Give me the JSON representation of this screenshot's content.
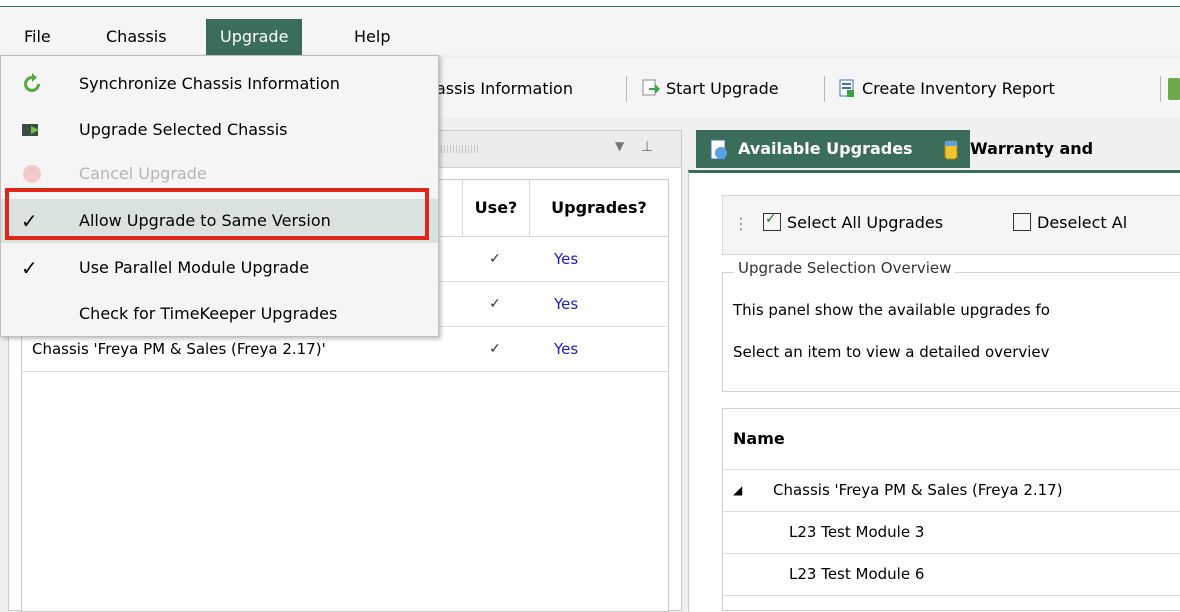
{
  "menubar": {
    "items": [
      {
        "label": "File"
      },
      {
        "label": "Chassis"
      },
      {
        "label": "Upgrade"
      },
      {
        "label": "Help"
      }
    ]
  },
  "toolbar": {
    "sync_label": "assis Information",
    "start_upgrade": "Start Upgrade",
    "inventory_report": "Create Inventory Report"
  },
  "upgrade_menu": {
    "items": [
      {
        "label": "Synchronize Chassis Information",
        "icon": "sync-icon",
        "enabled": true
      },
      {
        "label": "Upgrade Selected Chassis",
        "icon": "upgrade-chassis-icon",
        "enabled": true
      },
      {
        "label": "Cancel Upgrade",
        "icon": "cancel-icon",
        "enabled": false
      },
      {
        "label": "Allow Upgrade to Same Version",
        "checked": true,
        "highlighted": true
      },
      {
        "label": "Use Parallel Module Upgrade",
        "checked": true
      },
      {
        "label": "Check for TimeKeeper Upgrades",
        "checked": false
      }
    ],
    "check_glyph": "✓"
  },
  "chassis_grid": {
    "headers": [
      "Use?",
      "Upgrades?"
    ],
    "rows": [
      {
        "name": "",
        "use": true,
        "upgrades": "Yes"
      },
      {
        "name": "",
        "use": true,
        "upgrades": "Yes"
      },
      {
        "name": "Chassis 'Freya PM & Sales (Freya 2.17)'",
        "use": true,
        "upgrades": "Yes"
      }
    ]
  },
  "right_panel": {
    "tabs": [
      {
        "label": "Available Upgrades",
        "active": true
      },
      {
        "label": "Warranty and",
        "active": false
      }
    ],
    "select_all": "Select All Upgrades",
    "deselect_all": "Deselect Al",
    "group_title": "Upgrade Selection Overview",
    "overview_line1": "This panel show the available upgrades fo",
    "overview_line2": "Select an item to view a detailed overviev",
    "tree_header": "Name",
    "tree_rows": [
      {
        "label": "Chassis 'Freya PM & Sales (Freya 2.17)",
        "expander": "◢"
      },
      {
        "label": "L23 Test Module 3"
      },
      {
        "label": "L23 Test Module 6"
      }
    ]
  },
  "colors": {
    "accent": "#3b6e5a",
    "highlight_box": "#e0261b",
    "link_blue": "#1d1ad6"
  }
}
